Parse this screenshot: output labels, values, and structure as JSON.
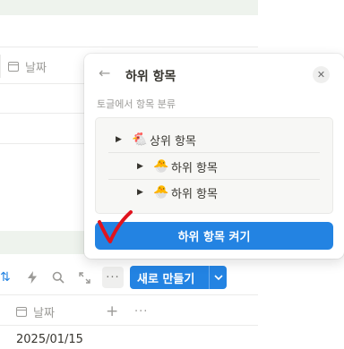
{
  "background": {
    "top_column": {
      "icon": "calendar-icon",
      "label": "날짜"
    },
    "toolbar": {
      "icons": [
        "sort-icon",
        "lightning-icon",
        "search-icon",
        "expand-icon",
        "more-icon"
      ],
      "more_label": "···",
      "new_button_label": "새로 만들기",
      "new_button_caret": "⌄"
    },
    "bottom_column": {
      "icon": "calendar-icon",
      "label": "날짜",
      "add_label": "+",
      "more_label": "···"
    },
    "date_value": "2025/01/15"
  },
  "popup": {
    "back_label": "←",
    "title": "하위 항목",
    "close_label": "✕",
    "subtitle": "토글에서 항목 분류",
    "tree": [
      {
        "arrow": "▶",
        "emoji": "🐔",
        "label": "상위 항목"
      },
      {
        "arrow": "▶",
        "emoji": "🐣",
        "label": "하위 항목"
      },
      {
        "arrow": "▶",
        "emoji": "🐣",
        "label": "하위 항목"
      }
    ],
    "enable_button": "하위 항목 켜기"
  },
  "colors": {
    "accent": "#2383e2",
    "annotation": "#e0141e"
  }
}
